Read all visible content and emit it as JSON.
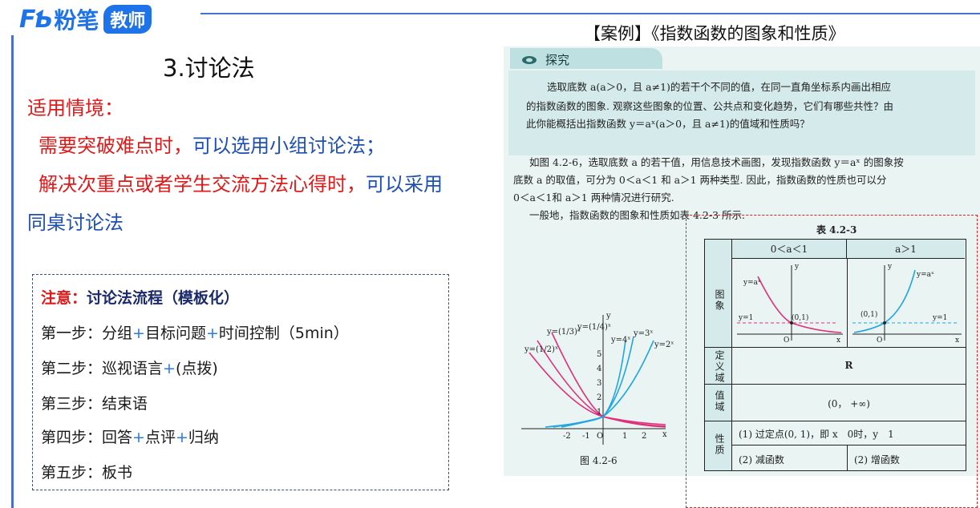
{
  "header": {
    "logo_fb": "FƄ",
    "logo_cn": "粉笔",
    "logo_badge": "教师"
  },
  "case_title": "【案例】《指数函数的图象和性质》",
  "left": {
    "section_title": "3.讨论法",
    "context_label": "适用情境：",
    "line1_red": "需要突破难点时，",
    "line1_blue": "可以选用小组讨论法；",
    "line2_red": "解决次重点或者学生交流方法心得时，",
    "line2_blue": "可以采用",
    "line3_blue": "同桌讨论法"
  },
  "note": {
    "title_red": "注意：",
    "title_rest": "讨论法流程（模板化）",
    "steps": [
      {
        "a": "第一步：分组",
        "p1": "+",
        "b": "目标问题",
        "p2": "+",
        "c": "时间控制（5min）"
      },
      {
        "a": "第二步：巡视语言",
        "p1": "+",
        "b": "(点拨)",
        "p2": "",
        "c": ""
      },
      {
        "a": "第三步：结束语",
        "p1": "",
        "b": "",
        "p2": "",
        "c": ""
      },
      {
        "a": "第四步：回答",
        "p1": "+",
        "b": "点评",
        "p2": "+",
        "c": "归纳"
      },
      {
        "a": "第五步：板书",
        "p1": "",
        "b": "",
        "p2": "",
        "c": ""
      }
    ]
  },
  "book": {
    "tab_label": "探究",
    "explore_lines": [
      "选取底数 a(a＞0，且 a≠1)的若干个不同的值，在同一直角坐标系内画出相应",
      "的指数函数的图象. 观察这些图象的位置、公共点和变化趋势，它们有哪些共性？由",
      "此你能概括出指数函数 y＝aˣ(a＞0，且 a≠1)的值域和性质吗？"
    ],
    "body_lines": [
      "如图 4.2-6，选取底数 a 的若干值，用信息技术画图，发现指数函数 y＝aˣ 的图象按",
      "底数 a 的取值，可分为 0＜a＜1 和 a＞1 两种类型. 因此，指数函数的性质也可以分",
      "0＜a＜1和 a＞1 两种情况进行研究.",
      "一般地，指数函数的图象和性质如表 4.2-3 所示."
    ],
    "figure_caption": "图 4.2-6",
    "graph_labels": {
      "l13": "y=(1/3)ˣ",
      "l14": "y=(1/4)ˣ",
      "l12": "y=(1/2)ˣ",
      "y4": "y=4ˣ",
      "y3": "y=3ˣ",
      "y2": "y=2ˣ",
      "axis_y": "y",
      "axis_x": "x",
      "t5": "5",
      "t4": "4",
      "t3": "3",
      "t2": "2",
      "t1": "1",
      "tn2": "-2",
      "tn1": "-1",
      "o": "O",
      "tx1": "1",
      "tx2": "2"
    }
  },
  "table": {
    "caption": "表 4.2-3",
    "col1": "0＜a＜1",
    "col2": "a＞1",
    "row_graph": "图象",
    "row_domain": "定义域",
    "row_range": "值域",
    "row_prop": "性质",
    "domain_val": "R",
    "range_val": "(0， +∞)",
    "prop1": "(1) 过定点(0, 1)，即 x　0时，y　1",
    "prop2a": "(2) 减函数",
    "prop2b": "(2) 增函数",
    "g_ax": "y=aˣ",
    "g_y1": "y=1",
    "g_pt": "(0,1)",
    "g_o": "O",
    "g_x": "x",
    "g_y": "y"
  }
}
